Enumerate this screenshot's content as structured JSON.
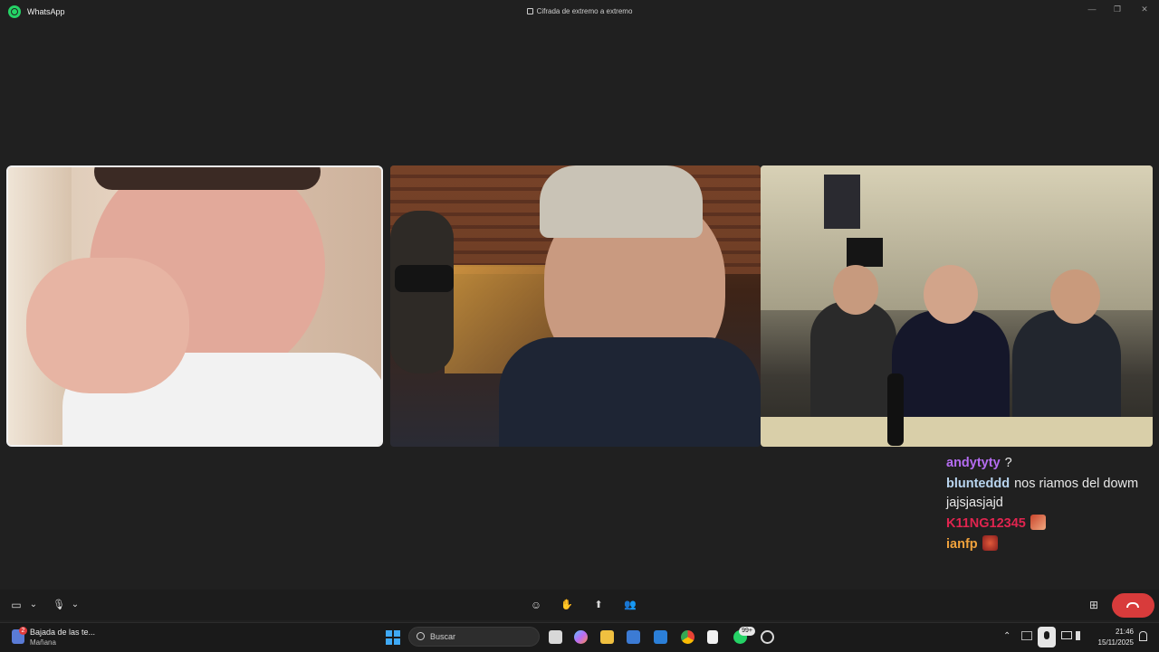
{
  "titlebar": {
    "app_name": "WhatsApp",
    "encryption_text": "Cifrada de extremo a extremo",
    "min_glyph": "—",
    "max_glyph": "❐",
    "close_glyph": "✕"
  },
  "chat": [
    {
      "user": "andytyty",
      "text": "?",
      "color": "#b46cf0",
      "emote": null
    },
    {
      "user": "blunteddd",
      "text": "nos riamos del dowm jajsjasjajd",
      "color": "#b8d4ee",
      "emote": null
    },
    {
      "user": "K11NG12345",
      "text": "",
      "color": "#e0244f",
      "emote": "emote-icon"
    },
    {
      "user": "ianfp",
      "text": "",
      "color": "#f0a23c",
      "emote": "emote-icon"
    }
  ],
  "controls": {
    "camera_glyph": "▭",
    "dropdown_glyph": "⌄",
    "mic_glyph": "🎙",
    "emoji_glyph": "☺",
    "hand_glyph": "✋",
    "share_glyph": "⬆",
    "people_glyph": "👥",
    "layout_glyph": "⊞"
  },
  "taskbar": {
    "weather_badge": "2",
    "weather_title": "Bajada de las te...",
    "weather_subtitle": "Mañana",
    "search_placeholder": "Buscar",
    "whatsapp_badge": "99+",
    "tray_chevron": "⌃",
    "time": "21:46",
    "date": "15/11/2025"
  }
}
